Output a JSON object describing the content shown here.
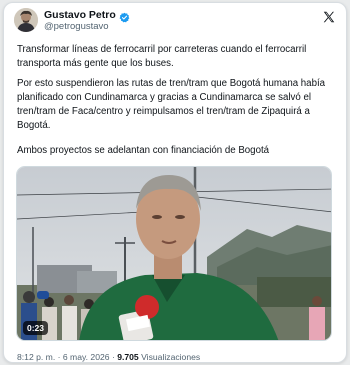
{
  "post": {
    "author_name": "Gustavo Petro",
    "author_handle": "@petrogustavo",
    "verified_icon": "verified-badge-icon",
    "platform_icon": "x-logo-icon",
    "paragraphs": [
      "Transformar líneas de ferrocarril por carreteras cuando el ferrocarril transporta más gente que los buses.",
      "Por esto suspendieron las rutas de tren/tram que Bogotá humana había planificado con Cundinamarca y gracias a Cundinamarca se salvó el tren/tram de Faca/centro y reimpulsamos el tren/tram de Zipaquirá a Bogotá.",
      "Ambos proyectos se adelantan con financiación de Bogotá"
    ],
    "video": {
      "duration": "0:23"
    },
    "meta": {
      "time": "8:12 p. m.",
      "separator": "·",
      "date": "6 may. 2026",
      "views_count": "9.705",
      "views_label": "Visualizaciones"
    }
  },
  "colors": {
    "text_primary": "#0f1419",
    "text_secondary": "#536471",
    "verified_blue": "#1d9bf0"
  }
}
